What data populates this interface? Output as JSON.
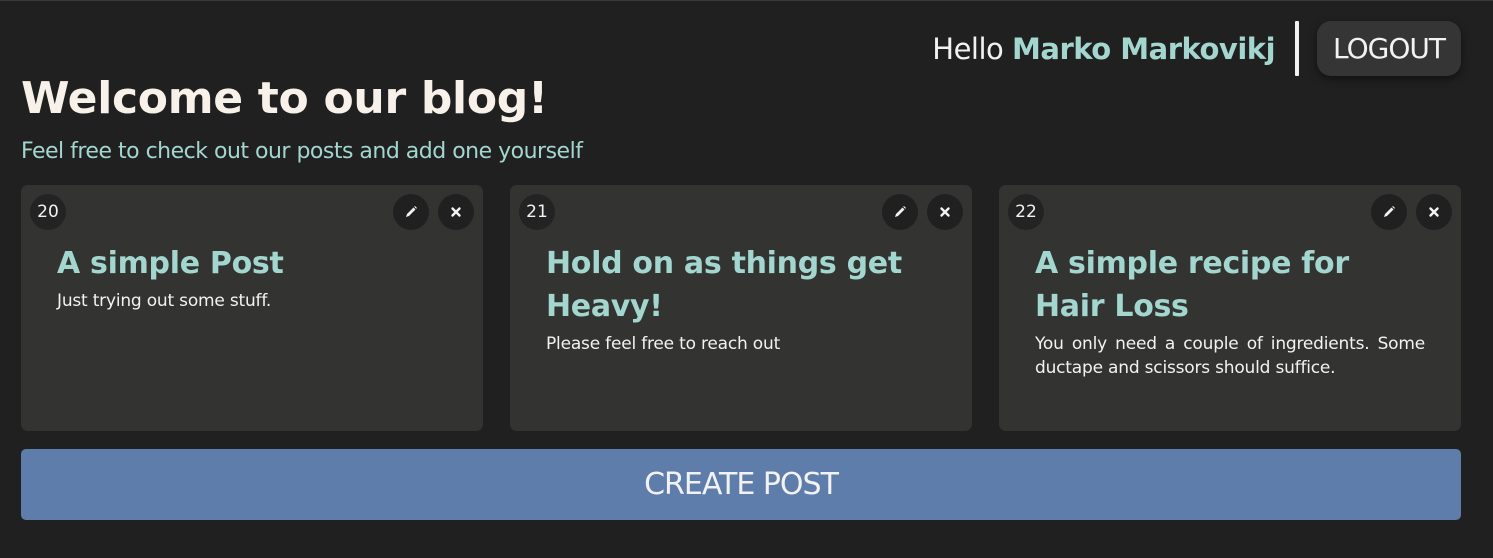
{
  "header": {
    "greeting": "Hello",
    "username": "Marko Markovikj",
    "logout_label": "LOGOUT"
  },
  "page": {
    "title": "Welcome to our blog!",
    "subtitle": "Feel free to check out our posts and add one yourself"
  },
  "posts": [
    {
      "id": "20",
      "title": "A simple Post",
      "body": "Just trying out some stuff."
    },
    {
      "id": "21",
      "title": "Hold on as things get Heavy!",
      "body": "Please feel free to reach out"
    },
    {
      "id": "22",
      "title": "A simple recipe for Hair Loss",
      "body": "You only need a couple of ingredients. Some ductape and scissors should suffice."
    }
  ],
  "actions": {
    "create_label": "CREATE POST",
    "edit_icon": "pencil-icon",
    "delete_icon": "close-icon"
  },
  "colors": {
    "background": "#202020",
    "accent": "#a3d6cf",
    "card": "#333432",
    "primary_button": "#5f7dab"
  }
}
